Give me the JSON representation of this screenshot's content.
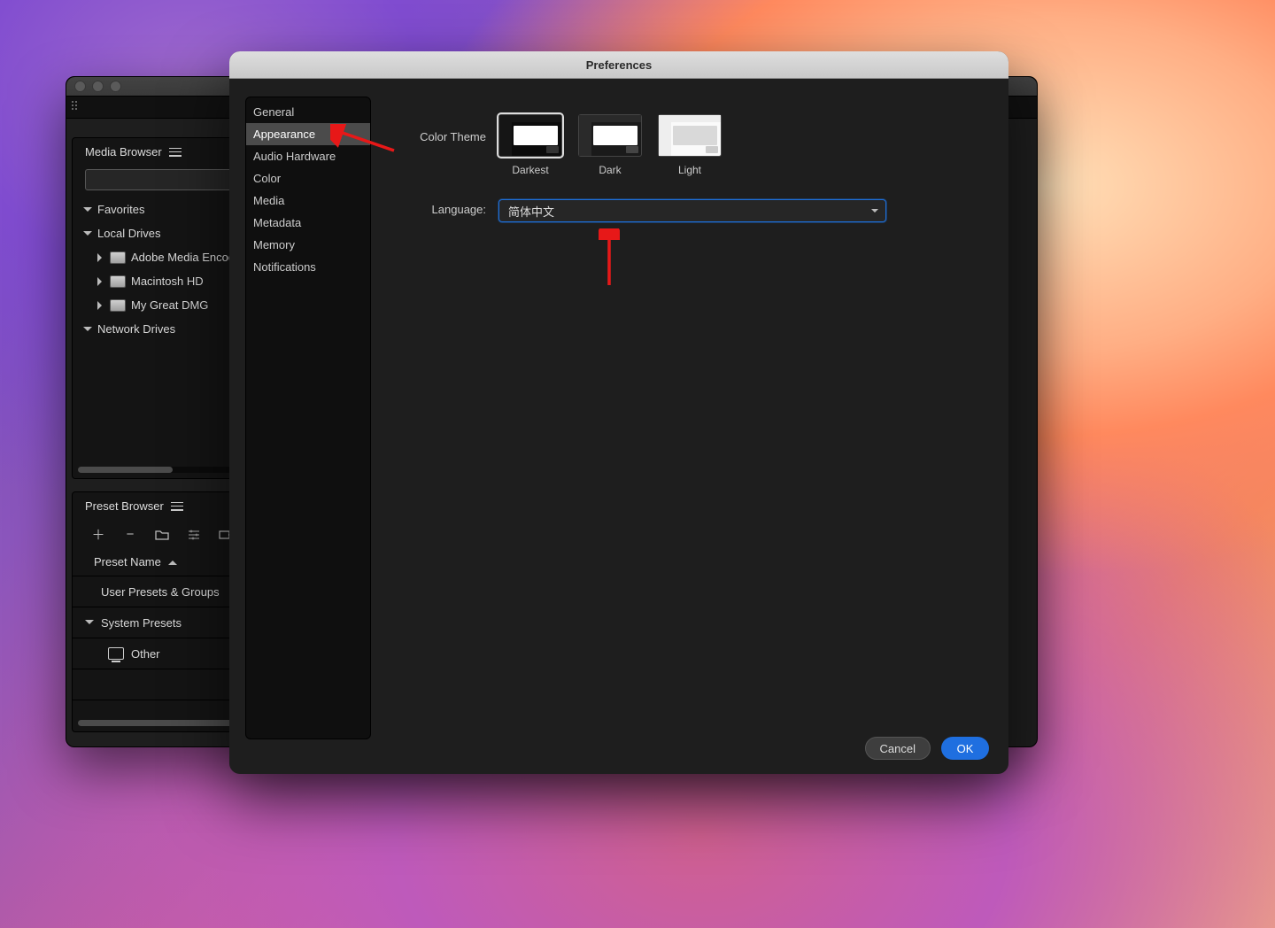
{
  "preferences": {
    "title": "Preferences",
    "nav": {
      "general": "General",
      "appearance": "Appearance",
      "audio_hardware": "Audio Hardware",
      "color": "Color",
      "media": "Media",
      "metadata": "Metadata",
      "memory": "Memory",
      "notifications": "Notifications"
    },
    "labels": {
      "color_theme": "Color Theme",
      "language": "Language:"
    },
    "themes": {
      "darkest": "Darkest",
      "dark": "Dark",
      "light": "Light"
    },
    "language_value": "简体中文",
    "buttons": {
      "cancel": "Cancel",
      "ok": "OK"
    }
  },
  "media_browser": {
    "title": "Media Browser",
    "tree": {
      "favorites": "Favorites",
      "local_drives": "Local Drives",
      "drives": {
        "ame": "Adobe Media Encode",
        "mac": "Macintosh HD",
        "dmg": "My Great DMG"
      },
      "network_drives": "Network Drives"
    }
  },
  "preset_browser": {
    "title": "Preset Browser",
    "column_header": "Preset Name",
    "rows": {
      "user_presets": "User Presets & Groups",
      "system_presets": "System Presets",
      "other": "Other"
    }
  }
}
